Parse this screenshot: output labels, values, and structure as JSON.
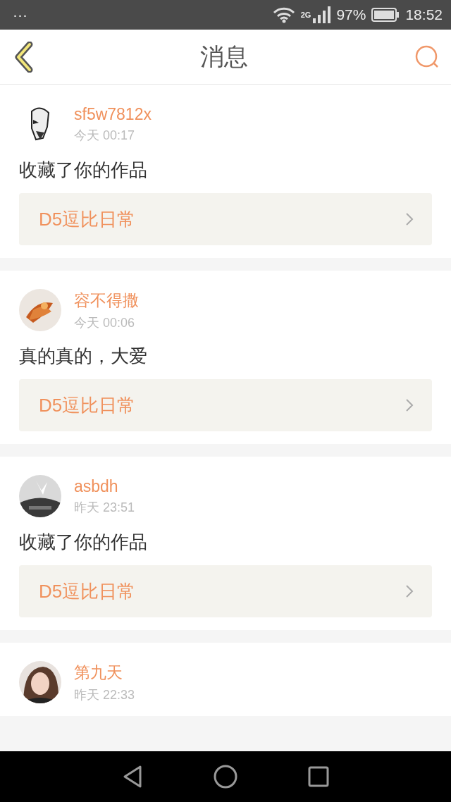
{
  "status_bar": {
    "menu": "···",
    "network": "2G",
    "battery": "97%",
    "time": "18:52"
  },
  "header": {
    "title": "消息"
  },
  "messages": [
    {
      "user": "sf5w7812x",
      "time": "今天 00:17",
      "text": "收藏了你的作品",
      "work": "D5逗比日常"
    },
    {
      "user": "容不得撒",
      "time": "今天 00:06",
      "text": "真的真的，大爱",
      "work": "D5逗比日常"
    },
    {
      "user": "asbdh",
      "time": "昨天 23:51",
      "text": "收藏了你的作品",
      "work": "D5逗比日常"
    },
    {
      "user": "第九天",
      "time": "昨天 22:33"
    }
  ]
}
